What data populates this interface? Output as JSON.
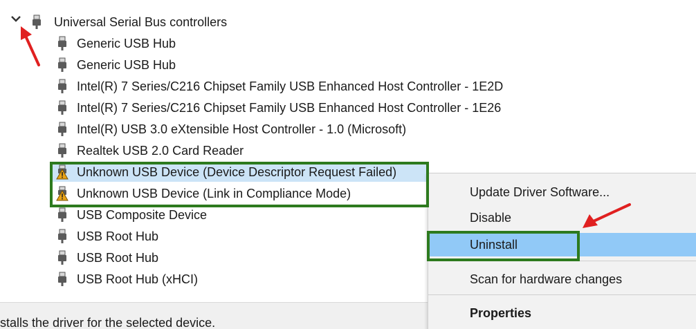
{
  "tree": {
    "root_label": "Universal Serial Bus controllers",
    "items": [
      {
        "label": "Generic USB Hub",
        "warning": false
      },
      {
        "label": "Generic USB Hub",
        "warning": false
      },
      {
        "label": "Intel(R) 7 Series/C216 Chipset Family USB Enhanced Host Controller - 1E2D",
        "warning": false
      },
      {
        "label": "Intel(R) 7 Series/C216 Chipset Family USB Enhanced Host Controller - 1E26",
        "warning": false
      },
      {
        "label": "Intel(R) USB 3.0 eXtensible Host Controller - 1.0 (Microsoft)",
        "warning": false
      },
      {
        "label": "Realtek USB 2.0 Card Reader",
        "warning": false
      },
      {
        "label": "Unknown USB Device (Device Descriptor Request Failed)",
        "warning": true,
        "selected": true
      },
      {
        "label": "Unknown USB Device (Link in Compliance Mode)",
        "warning": true
      },
      {
        "label": "USB Composite Device",
        "warning": false
      },
      {
        "label": "USB Root Hub",
        "warning": false
      },
      {
        "label": "USB Root Hub",
        "warning": false
      },
      {
        "label": "USB Root Hub (xHCI)",
        "warning": false
      }
    ]
  },
  "context_menu": {
    "items": [
      {
        "label": "Update Driver Software..."
      },
      {
        "label": "Disable"
      },
      {
        "label": "Uninstall",
        "hover": true
      },
      {
        "label": "Scan for hardware changes"
      },
      {
        "label": "Properties",
        "bold": true
      }
    ]
  },
  "statusbar": {
    "text": "stalls the driver for the selected device."
  },
  "colors": {
    "selection": "#cce4f7",
    "menu_hover": "#91c9f7",
    "highlight_box": "#2d7a1e",
    "annotation_arrow": "#e02020",
    "warning_icon": "#e8a317"
  },
  "icons": {
    "expand": "chevron-down-icon",
    "device": "usb-plug-icon",
    "warning": "warning-triangle-icon"
  }
}
